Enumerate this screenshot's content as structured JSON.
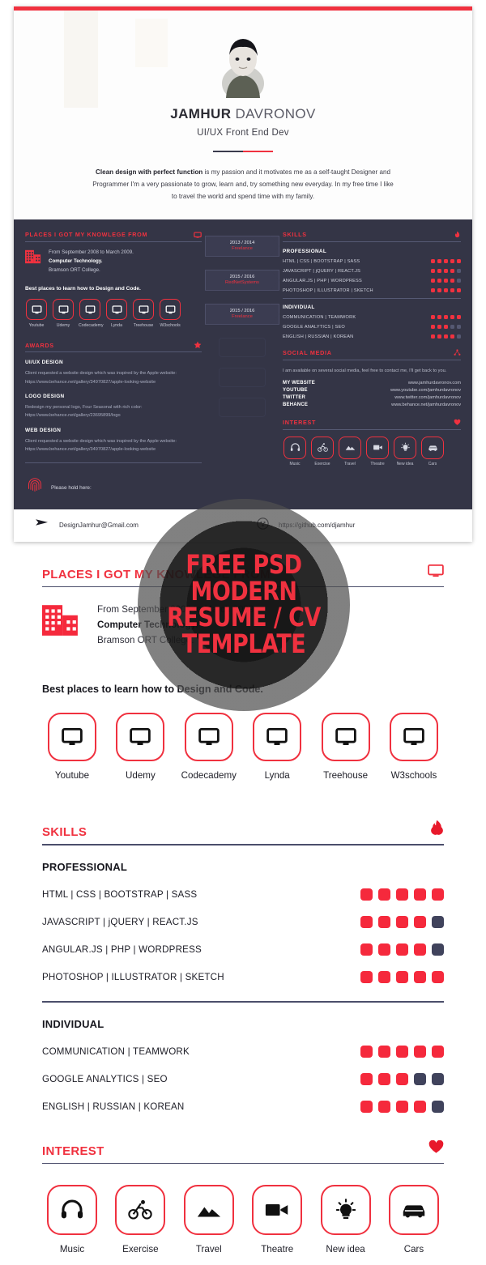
{
  "accent_red": "#f0313f",
  "dark_panel": "#343546",
  "profile": {
    "first_name": "JAMHUR",
    "last_name": "DAVRONOV",
    "role": "UI/UX  Front End Dev",
    "bio_bold": "Clean design with perfect function",
    "bio_rest": " is my passion and it motivates me as a self-taught Designer and Programmer I'm a very passionate to grow, learn and, try something new everyday.  In my free time I like to travel the world and spend time with my family."
  },
  "education": {
    "title": "PLACES I GOT MY KNOWLEGE FROM",
    "icon": "monitor-icon",
    "building_icon": "building-icon",
    "line1": "From September 2008 to March 2009.",
    "line2": "Computer Technology.",
    "line3": "Bramson ORT College.",
    "lead": "Best places to learn how to Design and Code.",
    "platforms": [
      {
        "label": "Youtube",
        "icon": "monitor-icon"
      },
      {
        "label": "Udemy",
        "icon": "monitor-icon"
      },
      {
        "label": "Codecademy",
        "icon": "monitor-icon"
      },
      {
        "label": "Lynda",
        "icon": "monitor-icon"
      },
      {
        "label": "Treehouse",
        "icon": "monitor-icon"
      },
      {
        "label": "W3schools",
        "icon": "monitor-icon"
      }
    ]
  },
  "awards": {
    "title": "AWARDS",
    "icon": "star-icon",
    "items": [
      {
        "name": "UI/UX DESIGN",
        "desc": "Client requested a website design which was inspired by the Apple website:   https://www.behance.net/gallery/34970827/apple-looking-website"
      },
      {
        "name": "LOGO DESIGN",
        "desc": "Redesign my personal logo, Four Seasonal with rich color:   https://www.behance.net/gallery/23695899/logo"
      },
      {
        "name": "WEB DESIGN",
        "desc": "Client requested a website design which was inspired by the Apple website:   https://www.behance.net/gallery/34970827/apple-looking-website"
      }
    ],
    "hold_label": "Please hold here:",
    "hold_icon": "fingerprint-icon"
  },
  "timeline": [
    {
      "years": "2013 / 2014",
      "company": "Freelance"
    },
    {
      "years": "2015 / 2016",
      "company": "RedNetSystems"
    },
    {
      "years": "2015 / 2016",
      "company": "Freelance"
    }
  ],
  "skills": {
    "title": "SKILLS",
    "icon": "flame-icon",
    "professional_label": "PROFESSIONAL",
    "individual_label": "INDIVIDUAL",
    "professional": [
      {
        "name": "HTML  |  CSS  |  BOOTSTRAP  |  SASS",
        "rating": 5,
        "max": 5
      },
      {
        "name": "JAVASCRIPT  |  jQUERY  |  REACT.JS",
        "rating": 4,
        "max": 5
      },
      {
        "name": "ANGULAR.JS  |  PHP  |  WORDPRESS",
        "rating": 4,
        "max": 5
      },
      {
        "name": "PHOTOSHOP  |  ILLUSTRATOR |  SKETCH",
        "rating": 5,
        "max": 5
      }
    ],
    "individual": [
      {
        "name": "COMMUNICATION  |  TEAMWORK",
        "rating": 5,
        "max": 5
      },
      {
        "name": "GOOGLE ANALYTICS  |  SEO",
        "rating": 3,
        "max": 5
      },
      {
        "name": "ENGLISH  |  RUSSIAN  |  KOREAN",
        "rating": 4,
        "max": 5
      }
    ]
  },
  "social": {
    "title": "SOCIAL MEDIA",
    "icon": "share-icon",
    "note": "I am available on several social media, feel free to contact me, I'll get back to you.",
    "links": [
      {
        "label": "MY WEBSITE",
        "url": "www.jamhurdavronov.com"
      },
      {
        "label": "YOUTUBE",
        "url": "www.youtube.com/jamhurdavronov"
      },
      {
        "label": "TWITTER",
        "url": "www.twitter.com/jamhurdavronov"
      },
      {
        "label": "BEHANCE",
        "url": "www.behance.net/jamhurdavronov"
      }
    ]
  },
  "interest": {
    "title": "INTEREST",
    "icon": "heart-icon",
    "items": [
      {
        "label": "Music",
        "icon": "headphones-icon"
      },
      {
        "label": "Exercise",
        "icon": "bicycle-icon"
      },
      {
        "label": "Travel",
        "icon": "mountain-icon"
      },
      {
        "label": "Theatre",
        "icon": "video-camera-icon"
      },
      {
        "label": "New idea",
        "icon": "lightbulb-icon"
      },
      {
        "label": "Cars",
        "icon": "car-icon"
      }
    ]
  },
  "footer": {
    "email": "DesignJamhur@Gmail.com",
    "email_icon": "send-icon",
    "github": "https://github.com/djamhur",
    "github_icon": "github-icon"
  },
  "watermark": {
    "line1": "FREE PSD",
    "line2": "MODERN",
    "line3": "RESUME  / CV",
    "line4": "TEMPLATE"
  }
}
